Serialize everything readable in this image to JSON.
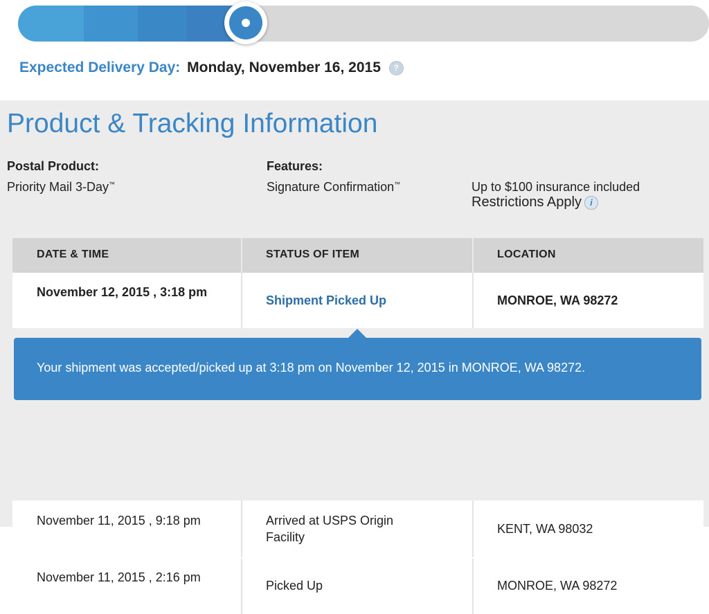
{
  "progress": {
    "steps_done": 4,
    "steps_total": 5,
    "fill_colors": [
      "#4aa3d8",
      "#3f94d0",
      "#3a88c6",
      "#3b80c0"
    ],
    "track_color": "#d8d8d8",
    "accent": "#3b86c6"
  },
  "delivery": {
    "label": "Expected Delivery Day:",
    "value": "Monday, November 16, 2015",
    "help_icon": "question-icon",
    "help_glyph": "?"
  },
  "section": {
    "title": "Product & Tracking Information"
  },
  "product": {
    "postal_label": "Postal Product:",
    "postal_value": "Priority Mail 3-Day",
    "tm": "™",
    "features_label": "Features:",
    "feature_1": "Signature Confirmation",
    "feature_2": "Up to $100 insurance included",
    "restrictions": "Restrictions Apply",
    "info_icon": "info-icon",
    "info_glyph": "i"
  },
  "table": {
    "headers": [
      "DATE & TIME",
      "STATUS OF ITEM",
      "LOCATION"
    ],
    "rows": [
      {
        "date": "November 12, 2015 , 3:18 pm",
        "status": "Shipment Picked Up",
        "location": "MONROE, WA 98272"
      },
      {
        "date": "November 11, 2015 , 9:18 pm",
        "status": "Arrived at USPS Origin Facility",
        "location": "KENT, WA 98032"
      },
      {
        "date": "November 11, 2015 , 2:16 pm",
        "status": "Picked Up",
        "location": "MONROE, WA 98272"
      }
    ]
  },
  "banner": {
    "text": "Your shipment was accepted/picked up at 3:18 pm on November 12, 2015 in MONROE, WA 98272."
  }
}
